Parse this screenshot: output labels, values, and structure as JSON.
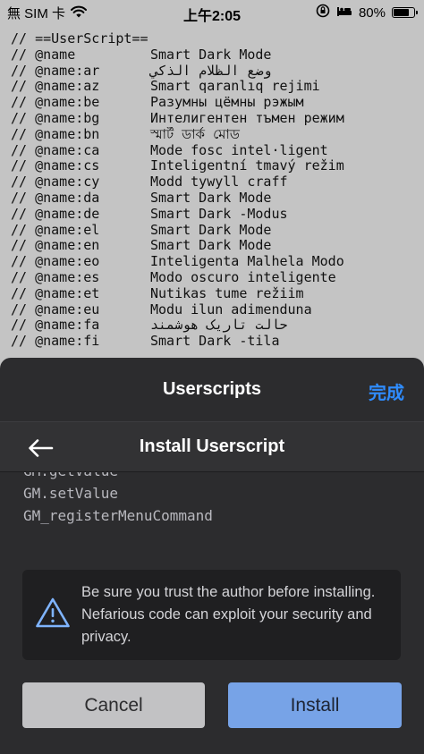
{
  "status_bar": {
    "carrier": "無 SIM 卡",
    "time": "上午2:05",
    "battery_percent": "80%",
    "battery_level": 0.8
  },
  "code_lines": [
    {
      "key": "// ==UserScript==",
      "value": ""
    },
    {
      "key": "// @name",
      "value": "Smart Dark Mode"
    },
    {
      "key": "// @name:ar",
      "value": "وضع الظلام الذكي"
    },
    {
      "key": "// @name:az",
      "value": "Smart qaranlıq rejimi"
    },
    {
      "key": "// @name:be",
      "value": "Разумны цёмны рэжым"
    },
    {
      "key": "// @name:bg",
      "value": "Интелигентен тъмен режим"
    },
    {
      "key": "// @name:bn",
      "value": "স্মার্ট ডার্ক মোড"
    },
    {
      "key": "// @name:ca",
      "value": "Mode fosc intel·ligent"
    },
    {
      "key": "// @name:cs",
      "value": "Inteligentní tmavý režim"
    },
    {
      "key": "// @name:cy",
      "value": "Modd tywyll craff"
    },
    {
      "key": "// @name:da",
      "value": "Smart Dark Mode"
    },
    {
      "key": "// @name:de",
      "value": "Smart Dark -Modus"
    },
    {
      "key": "// @name:el",
      "value": "Smart Dark Mode"
    },
    {
      "key": "// @name:en",
      "value": "Smart Dark Mode"
    },
    {
      "key": "// @name:eo",
      "value": "Inteligenta Malhela Modo"
    },
    {
      "key": "// @name:es",
      "value": "Modo oscuro inteligente"
    },
    {
      "key": "// @name:et",
      "value": "Nutikas tume režiim"
    },
    {
      "key": "// @name:eu",
      "value": "Modu ilun adimenduna"
    },
    {
      "key": "// @name:fa",
      "value": "حالت تاریک هوشمند"
    },
    {
      "key": "// @name:fi",
      "value": "Smart Dark -tila"
    }
  ],
  "sheet": {
    "title": "Userscripts",
    "done_label": "完成",
    "install_title": "Install Userscript",
    "grants_partial": "GM.getValue",
    "grants": [
      "GM.setValue",
      "GM_registerMenuCommand"
    ],
    "warning_text": "Be sure you trust the author before installing. Nefarious code can exploit your security and privacy.",
    "cancel_label": "Cancel",
    "install_label": "Install"
  }
}
